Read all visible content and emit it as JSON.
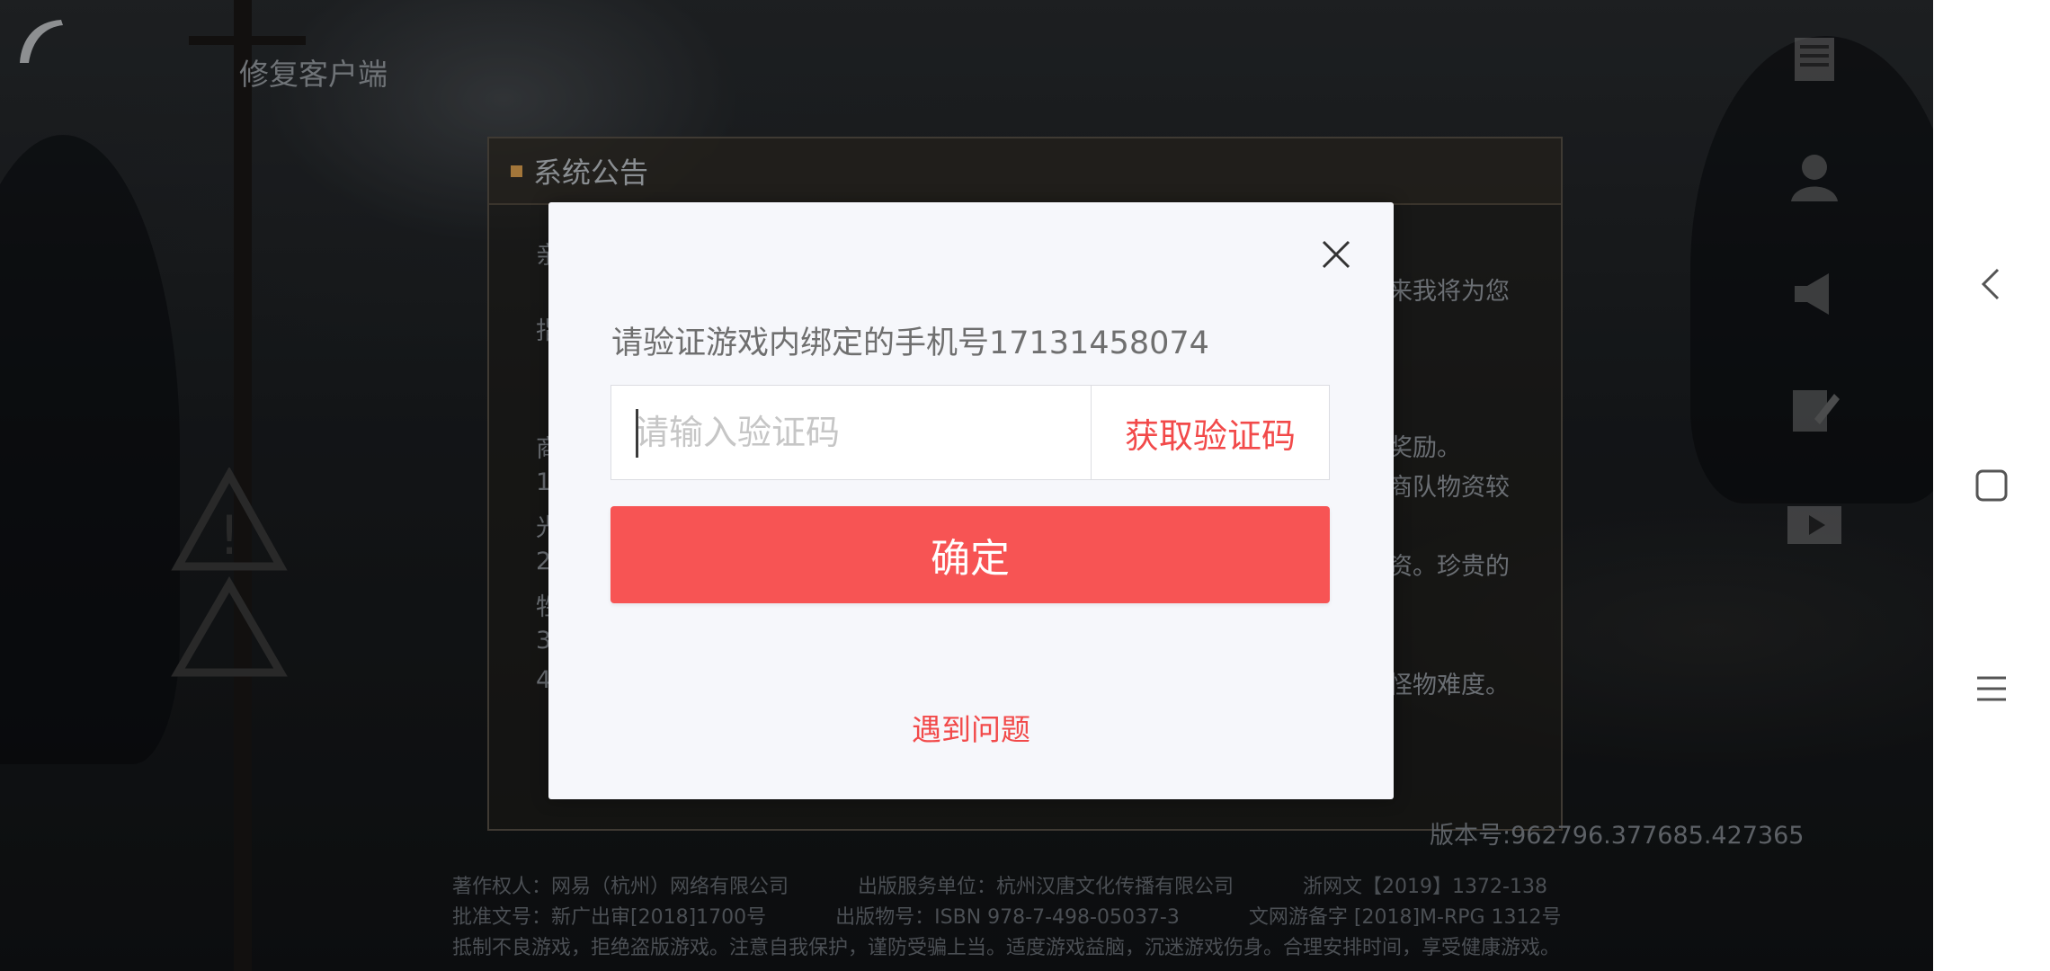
{
  "game": {
    "repair_client": "修复客户端",
    "notice": {
      "title": "系统公告",
      "left_fragments": [
        "亲",
        "指",
        "商",
        "1",
        "光",
        "2",
        "牲",
        "3",
        "4"
      ],
      "right_fragments": [
        "来我将为您",
        "奖励。",
        "商队物资较",
        "资。珍贵的",
        "怪物难度。"
      ]
    },
    "version": "版本号:962796.377685.427365",
    "legal": [
      [
        "著作权人：网易（杭州）网络有限公司",
        "出版服务单位：杭州汉唐文化传播有限公司",
        "浙网文【2019】1372-138"
      ],
      [
        "批准文号：新广出审[2018]1700号",
        "出版物号：ISBN 978-7-498-05037-3",
        "文网游备字 [2018]M-RPG 1312号"
      ],
      [
        "抵制不良游戏，拒绝盗版游戏。注意自我保护，谨防受骗上当。适度游戏益脑，沉迷游戏伤身。合理安排时间，享受健康游戏。"
      ]
    ],
    "side_icons": [
      "notepad-icon",
      "user-icon",
      "megaphone-icon",
      "edit-icon",
      "video-icon"
    ]
  },
  "modal": {
    "verify_text": "请验证游戏内绑定的手机号17131458074",
    "code_input": {
      "value": "",
      "placeholder": "请输入验证码"
    },
    "get_code_label": "获取验证码",
    "confirm_label": "确定",
    "problem_label": "遇到问题",
    "accent_color": "#f75454"
  },
  "navbar": {
    "icons": [
      "back-chevron-icon",
      "recent-apps-square-icon",
      "menu-lines-icon"
    ]
  }
}
